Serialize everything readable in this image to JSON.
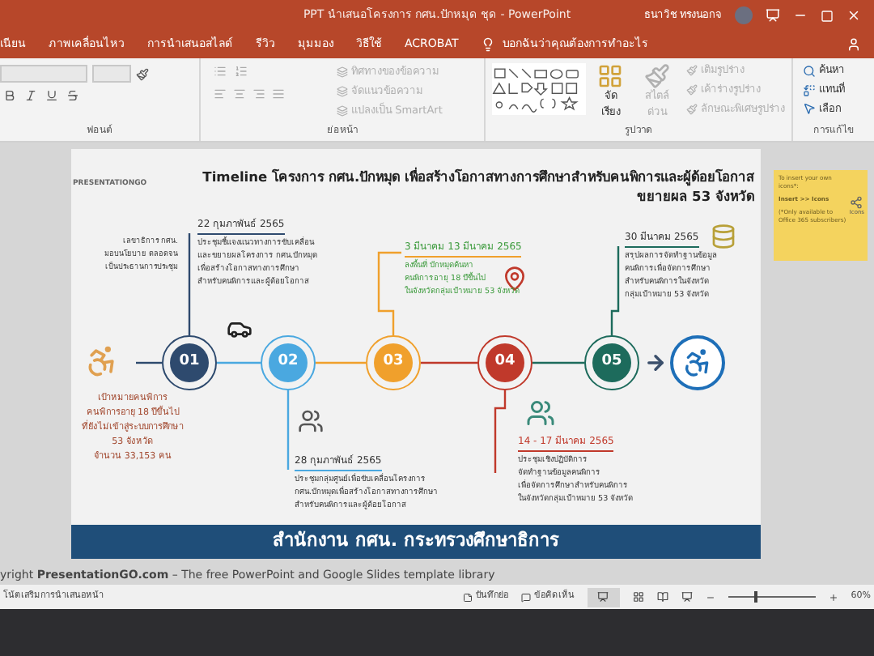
{
  "window": {
    "title": "PPT นำเสนอโครงการ กศน.ปักหมุด ชุด - PowerPoint",
    "user": "ธนาวิช ทรงนอกจ"
  },
  "ribbon_tabs": [
    {
      "label": "เนียน"
    },
    {
      "label": "ภาพเคลื่อนไหว"
    },
    {
      "label": "การนำเสนอสไลด์"
    },
    {
      "label": "รีวิว"
    },
    {
      "label": "มุมมอง"
    },
    {
      "label": "วิธีใช้"
    },
    {
      "label": "ACROBAT"
    }
  ],
  "tell_me": "บอกฉันว่าคุณต้องการทำอะไร",
  "ribbon": {
    "font_group": "ฟอนต์",
    "paragraph_group": "ย่อหน้า",
    "paragraph_commands": [
      {
        "label": "ทิศทางของข้อความ",
        "disabled": true
      },
      {
        "label": "จัดแนวข้อความ",
        "disabled": true
      },
      {
        "label": "แปลงเป็น SmartArt",
        "disabled": true
      }
    ],
    "drawing_group": "รูปวาด",
    "arrange": "จัดเรียง",
    "quick_styles": {
      "label": "สไตล์ด่วน",
      "disabled": true
    },
    "shape_commands": [
      {
        "label": "เติมรูปร่าง",
        "disabled": true
      },
      {
        "label": "เค้าร่างรูปร่าง",
        "disabled": true
      },
      {
        "label": "ลักษณะพิเศษรูปร่าง",
        "disabled": true
      }
    ],
    "editing_group": "การแก้ไข",
    "editing_commands": [
      {
        "label": "ค้นหา"
      },
      {
        "label": "แทนที่"
      },
      {
        "label": "เลือก"
      }
    ]
  },
  "slide": {
    "logo": "PRESENTATIONGO",
    "title_line_1": "Timeline โครงการ กศน.ปักหมุด เพื่อสร้างโอกาสทางการศึกษาสำหรับคนพิการและผู้ด้อยโอกาส",
    "title_line_2": "ขยายผล 53 จังหวัด",
    "steps": [
      {
        "number": "01",
        "color": "#2e4a6e"
      },
      {
        "number": "02",
        "color": "#4aa8e0"
      },
      {
        "number": "03",
        "color": "#f0a02c"
      },
      {
        "number": "04",
        "color": "#c0392b"
      },
      {
        "number": "05",
        "color": "#1d6b5c"
      }
    ],
    "side_note": [
      "เลขาธิการ กศน.",
      "มอบนโยบาย ตลอดจน",
      "เป็นประธานการประชุม"
    ],
    "target": [
      "เป้าหมายคนพิการ",
      "คนพิการอายุ 18 ปีขึ้นไป",
      "ที่ยังไม่เข้าสู่ระบบการศึกษา",
      "53 จังหวัด",
      "จำนวน 33,153 คน"
    ],
    "events": [
      {
        "date": "22 กุมภาพันธ์ 2565",
        "color": "#2e4a6e",
        "lines": [
          "ประชุมชี้แจงแนวทางการขับเคลื่อน",
          "และขยายผลโครงการ กศน.ปักหมุด",
          "เพื่อสร้างโอกาสทางการศึกษา",
          "สำหรับคนพิการและผู้ด้อยโอกาส"
        ]
      },
      {
        "date": "28 กุมภาพันธ์ 2565",
        "color": "#4aa8e0",
        "lines": [
          "ประชุมกลุ่มศูนย์เพื่อขับเคลื่อนโครงการ",
          "กศน.ปักหมุดเพื่อสร้างโอกาสทางการศึกษา",
          "สำหรับคนพิการและผู้ด้อยโอกาส"
        ]
      },
      {
        "date": "3 มีนาคม 13 มีนาคม 2565",
        "color": "#f0a02c",
        "lines": [
          "ลงพื้นที่ ปักหมุดค้นหา",
          "คนพิการอายุ 18 ปีขึ้นไป",
          "ในจังหวัดกลุ่มเป้าหมาย 53 จังหวัด"
        ]
      },
      {
        "date": "14 - 17 มีนาคม 2565",
        "color": "#c0392b",
        "lines": [
          "ประชุมเชิงปฏิบัติการ",
          "จัดทำฐานข้อมูลคนพิการ",
          "เพื่อจัดการศึกษาสำหรับคนพิการ",
          "ในจังหวัดกลุ่มเป้าหมาย 53 จังหวัด"
        ]
      },
      {
        "date": "30 มีนาคม 2565",
        "color": "#1d6b5c",
        "lines": [
          "สรุปผลการจัดทำฐานข้อมูล",
          "คนพิการเพื่อจัดการศึกษา",
          "สำหรับคนพิการในจังหวัด",
          "กลุ่มเป้าหมาย 53 จังหวัด"
        ]
      }
    ],
    "banner": "สำนักงาน กศน. กระทรวงศึกษาธิการ"
  },
  "sticky_note": {
    "lines": [
      "To insert your own icons*:",
      "**Insert >> Icons**",
      "(*Only available to Office 365 subscribers)"
    ],
    "icon_label": "Icons"
  },
  "footer": "yright **PresentationGO.com** – The free PowerPoint and Google Slides template library",
  "status_bar": {
    "left": "โน้ตเสริมการนำเสนอหน้า",
    "notes": "บันทึกย่อ",
    "comments": "ข้อคิดเห็น",
    "zoom": "60%",
    "level": 0.3
  }
}
